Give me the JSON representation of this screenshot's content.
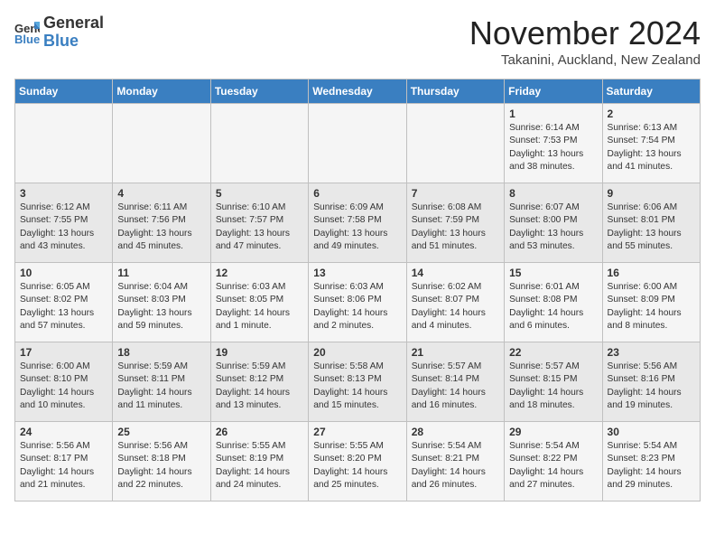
{
  "logo": {
    "general": "General",
    "blue": "Blue"
  },
  "header": {
    "month": "November 2024",
    "location": "Takanini, Auckland, New Zealand"
  },
  "days_of_week": [
    "Sunday",
    "Monday",
    "Tuesday",
    "Wednesday",
    "Thursday",
    "Friday",
    "Saturday"
  ],
  "weeks": [
    [
      {
        "day": "",
        "info": ""
      },
      {
        "day": "",
        "info": ""
      },
      {
        "day": "",
        "info": ""
      },
      {
        "day": "",
        "info": ""
      },
      {
        "day": "",
        "info": ""
      },
      {
        "day": "1",
        "info": "Sunrise: 6:14 AM\nSunset: 7:53 PM\nDaylight: 13 hours\nand 38 minutes."
      },
      {
        "day": "2",
        "info": "Sunrise: 6:13 AM\nSunset: 7:54 PM\nDaylight: 13 hours\nand 41 minutes."
      }
    ],
    [
      {
        "day": "3",
        "info": "Sunrise: 6:12 AM\nSunset: 7:55 PM\nDaylight: 13 hours\nand 43 minutes."
      },
      {
        "day": "4",
        "info": "Sunrise: 6:11 AM\nSunset: 7:56 PM\nDaylight: 13 hours\nand 45 minutes."
      },
      {
        "day": "5",
        "info": "Sunrise: 6:10 AM\nSunset: 7:57 PM\nDaylight: 13 hours\nand 47 minutes."
      },
      {
        "day": "6",
        "info": "Sunrise: 6:09 AM\nSunset: 7:58 PM\nDaylight: 13 hours\nand 49 minutes."
      },
      {
        "day": "7",
        "info": "Sunrise: 6:08 AM\nSunset: 7:59 PM\nDaylight: 13 hours\nand 51 minutes."
      },
      {
        "day": "8",
        "info": "Sunrise: 6:07 AM\nSunset: 8:00 PM\nDaylight: 13 hours\nand 53 minutes."
      },
      {
        "day": "9",
        "info": "Sunrise: 6:06 AM\nSunset: 8:01 PM\nDaylight: 13 hours\nand 55 minutes."
      }
    ],
    [
      {
        "day": "10",
        "info": "Sunrise: 6:05 AM\nSunset: 8:02 PM\nDaylight: 13 hours\nand 57 minutes."
      },
      {
        "day": "11",
        "info": "Sunrise: 6:04 AM\nSunset: 8:03 PM\nDaylight: 13 hours\nand 59 minutes."
      },
      {
        "day": "12",
        "info": "Sunrise: 6:03 AM\nSunset: 8:05 PM\nDaylight: 14 hours\nand 1 minute."
      },
      {
        "day": "13",
        "info": "Sunrise: 6:03 AM\nSunset: 8:06 PM\nDaylight: 14 hours\nand 2 minutes."
      },
      {
        "day": "14",
        "info": "Sunrise: 6:02 AM\nSunset: 8:07 PM\nDaylight: 14 hours\nand 4 minutes."
      },
      {
        "day": "15",
        "info": "Sunrise: 6:01 AM\nSunset: 8:08 PM\nDaylight: 14 hours\nand 6 minutes."
      },
      {
        "day": "16",
        "info": "Sunrise: 6:00 AM\nSunset: 8:09 PM\nDaylight: 14 hours\nand 8 minutes."
      }
    ],
    [
      {
        "day": "17",
        "info": "Sunrise: 6:00 AM\nSunset: 8:10 PM\nDaylight: 14 hours\nand 10 minutes."
      },
      {
        "day": "18",
        "info": "Sunrise: 5:59 AM\nSunset: 8:11 PM\nDaylight: 14 hours\nand 11 minutes."
      },
      {
        "day": "19",
        "info": "Sunrise: 5:59 AM\nSunset: 8:12 PM\nDaylight: 14 hours\nand 13 minutes."
      },
      {
        "day": "20",
        "info": "Sunrise: 5:58 AM\nSunset: 8:13 PM\nDaylight: 14 hours\nand 15 minutes."
      },
      {
        "day": "21",
        "info": "Sunrise: 5:57 AM\nSunset: 8:14 PM\nDaylight: 14 hours\nand 16 minutes."
      },
      {
        "day": "22",
        "info": "Sunrise: 5:57 AM\nSunset: 8:15 PM\nDaylight: 14 hours\nand 18 minutes."
      },
      {
        "day": "23",
        "info": "Sunrise: 5:56 AM\nSunset: 8:16 PM\nDaylight: 14 hours\nand 19 minutes."
      }
    ],
    [
      {
        "day": "24",
        "info": "Sunrise: 5:56 AM\nSunset: 8:17 PM\nDaylight: 14 hours\nand 21 minutes."
      },
      {
        "day": "25",
        "info": "Sunrise: 5:56 AM\nSunset: 8:18 PM\nDaylight: 14 hours\nand 22 minutes."
      },
      {
        "day": "26",
        "info": "Sunrise: 5:55 AM\nSunset: 8:19 PM\nDaylight: 14 hours\nand 24 minutes."
      },
      {
        "day": "27",
        "info": "Sunrise: 5:55 AM\nSunset: 8:20 PM\nDaylight: 14 hours\nand 25 minutes."
      },
      {
        "day": "28",
        "info": "Sunrise: 5:54 AM\nSunset: 8:21 PM\nDaylight: 14 hours\nand 26 minutes."
      },
      {
        "day": "29",
        "info": "Sunrise: 5:54 AM\nSunset: 8:22 PM\nDaylight: 14 hours\nand 27 minutes."
      },
      {
        "day": "30",
        "info": "Sunrise: 5:54 AM\nSunset: 8:23 PM\nDaylight: 14 hours\nand 29 minutes."
      }
    ]
  ]
}
